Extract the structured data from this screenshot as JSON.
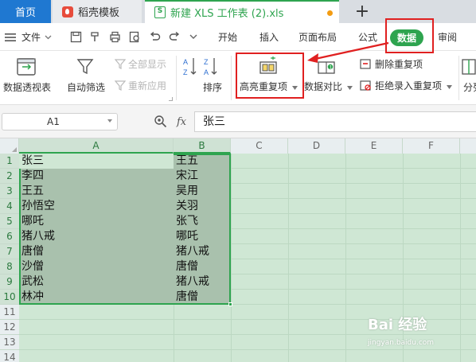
{
  "tabs": {
    "home": "首页",
    "templates": "稻壳模板",
    "document": "新建 XLS 工作表 (2).xls",
    "new_tab": "+"
  },
  "menu": {
    "file": "文件",
    "items": [
      "开始",
      "插入",
      "页面布局",
      "公式",
      "数据",
      "审阅"
    ],
    "active": "数据"
  },
  "ribbon": {
    "pivot_table": "数据透视表",
    "auto_filter": "自动筛选",
    "show_all": "全部显示",
    "reapply": "重新应用",
    "sort": "排序",
    "highlight_duplicates": "高亮重复项",
    "data_compare": "数据对比",
    "remove_duplicates": "删除重复项",
    "reject_duplicates": "拒绝录入重复项",
    "split": "分列"
  },
  "formula_bar": {
    "cell_ref": "A1",
    "fx": "fx",
    "content": "张三"
  },
  "columns": [
    "A",
    "B",
    "C",
    "D",
    "E",
    "F"
  ],
  "rows": [
    "1",
    "2",
    "3",
    "4",
    "5",
    "6",
    "7",
    "8",
    "9",
    "10",
    "11",
    "12",
    "13",
    "14"
  ],
  "cells": {
    "A": [
      "张三",
      "李四",
      "王五",
      "孙悟空",
      "哪吒",
      "猪八戒",
      "唐僧",
      "沙僧",
      "武松",
      "林冲"
    ],
    "B": [
      "王五",
      "宋江",
      "吴用",
      "关羽",
      "张飞",
      "哪吒",
      "猪八戒",
      "唐僧",
      "猪八戒",
      "唐僧"
    ]
  },
  "watermark": {
    "logo": "Bai 经验",
    "url": "jingyan.baidu.com"
  },
  "colors": {
    "accent_green": "#2ea44f",
    "annotation_red": "#e02020",
    "home_tab_blue": "#1f78d1"
  }
}
